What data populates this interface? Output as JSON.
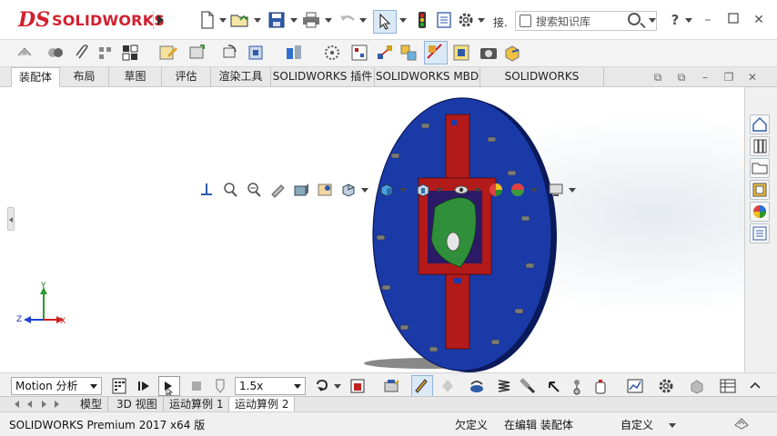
{
  "app": {
    "logo_ds": "DS",
    "logo_name": "SOLIDWORKS"
  },
  "titlebar": {
    "search_placeholder": "搜索知识库",
    "truncated_label": "接."
  },
  "tabs": [
    {
      "label": "装配体",
      "active": true
    },
    {
      "label": "布局"
    },
    {
      "label": "草图"
    },
    {
      "label": "评估"
    },
    {
      "label": "渲染工具"
    },
    {
      "label": "SOLIDWORKS 插件"
    },
    {
      "label": "SOLIDWORKS MBD"
    },
    {
      "label": "SOLIDWORKS Visualize"
    }
  ],
  "triad": {
    "y": "Y",
    "x": "X",
    "z": "Z"
  },
  "motion": {
    "study_type": "Motion 分析",
    "speed": "1.5x"
  },
  "bottom_tabs": [
    {
      "label": "模型"
    },
    {
      "label": "3D 视图"
    },
    {
      "label": "运动算例 1"
    },
    {
      "label": "运动算例 2",
      "active": true
    }
  ],
  "status": {
    "product": "SOLIDWORKS Premium 2017 x64 版",
    "definition": "欠定义",
    "editing": "在编辑 装配体",
    "units": "自定义"
  },
  "colors": {
    "brand_red": "#d2202f",
    "disc_blue": "#1a3aa8",
    "yoke_red": "#b31a1a",
    "cam_green": "#2f8f3a"
  }
}
